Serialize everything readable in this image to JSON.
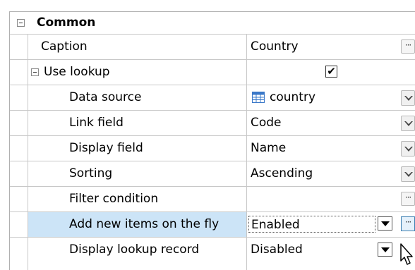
{
  "category": {
    "label": "Common"
  },
  "rows": {
    "caption": {
      "name": "Caption",
      "value": "Country",
      "button": "···"
    },
    "use_lookup": {
      "name": "Use lookup",
      "checked_mark": "✔"
    },
    "data_source": {
      "name": "Data source",
      "value": "country",
      "icon": "table-icon"
    },
    "link_field": {
      "name": "Link field",
      "value": "Code"
    },
    "display_field": {
      "name": "Display field",
      "value": "Name"
    },
    "sorting": {
      "name": "Sorting",
      "value": "Ascending"
    },
    "filter_condition": {
      "name": "Filter condition",
      "value": "",
      "button": "···"
    },
    "add_new_items": {
      "name": "Add new items on the fly",
      "value": "Enabled",
      "button": "···"
    },
    "display_lookup_record": {
      "name": "Display lookup record",
      "value": "Disabled"
    }
  },
  "colors": {
    "selection": "#cce4f7",
    "grid_line": "#c8c8c8",
    "icon_blue": "#3a78c8"
  }
}
